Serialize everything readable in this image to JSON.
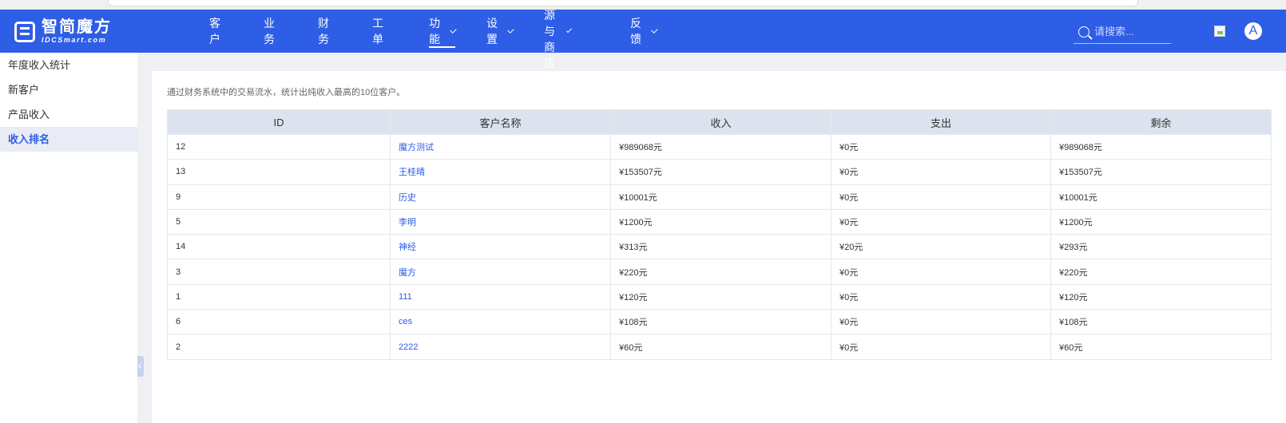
{
  "header": {
    "logo_title": "智简魔方",
    "logo_sub": "IDCSmart.com",
    "nav": [
      {
        "label": "客户",
        "dropdown": false,
        "active": false
      },
      {
        "label": "业务",
        "dropdown": false,
        "active": false
      },
      {
        "label": "财务",
        "dropdown": false,
        "active": false
      },
      {
        "label": "工单",
        "dropdown": false,
        "active": false
      },
      {
        "label": "功能",
        "dropdown": true,
        "active": true
      },
      {
        "label": "设置",
        "dropdown": true,
        "active": false
      },
      {
        "label": "资源与商店",
        "dropdown": true,
        "active": false
      },
      {
        "label": "反馈",
        "dropdown": true,
        "active": false
      }
    ],
    "search_placeholder": "请搜索...",
    "avatar_letter": "A"
  },
  "sidebar": {
    "items": [
      {
        "label": "年度收入统计",
        "active": false
      },
      {
        "label": "新客户",
        "active": false
      },
      {
        "label": "产品收入",
        "active": false
      },
      {
        "label": "收入排名",
        "active": true
      }
    ]
  },
  "main": {
    "description": "通过财务系统中的交易流水，统计出纯收入最高的10位客户。",
    "table": {
      "headers": [
        "ID",
        "客户名称",
        "收入",
        "支出",
        "剩余"
      ],
      "rows": [
        {
          "id": "12",
          "name": "魔方测试",
          "income": "¥989068元",
          "expense": "¥0元",
          "remain": "¥989068元"
        },
        {
          "id": "13",
          "name": "王桂晴",
          "income": "¥153507元",
          "expense": "¥0元",
          "remain": "¥153507元"
        },
        {
          "id": "9",
          "name": "历史",
          "income": "¥10001元",
          "expense": "¥0元",
          "remain": "¥10001元"
        },
        {
          "id": "5",
          "name": "李明",
          "income": "¥1200元",
          "expense": "¥0元",
          "remain": "¥1200元"
        },
        {
          "id": "14",
          "name": "神经",
          "income": "¥313元",
          "expense": "¥20元",
          "remain": "¥293元"
        },
        {
          "id": "3",
          "name": "魔方",
          "income": "¥220元",
          "expense": "¥0元",
          "remain": "¥220元"
        },
        {
          "id": "1",
          "name": "111",
          "income": "¥120元",
          "expense": "¥0元",
          "remain": "¥120元"
        },
        {
          "id": "6",
          "name": "ces",
          "income": "¥108元",
          "expense": "¥0元",
          "remain": "¥108元"
        },
        {
          "id": "2",
          "name": "2222",
          "income": "¥60元",
          "expense": "¥0元",
          "remain": "¥60元"
        }
      ]
    }
  },
  "colors": {
    "brand": "#2e5de6",
    "header_bg": "#2e5de6",
    "table_header_bg": "#dde3ee",
    "link": "#2e5de6"
  }
}
